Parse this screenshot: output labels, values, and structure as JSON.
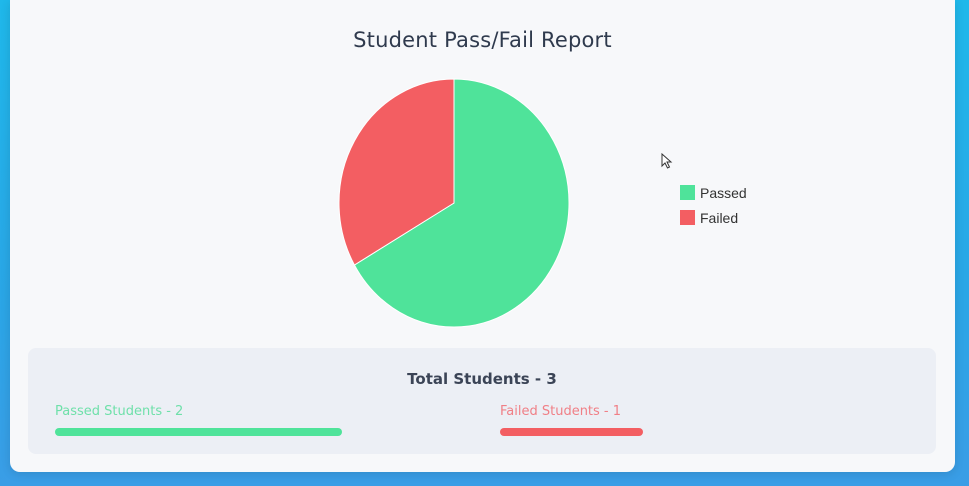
{
  "chart_data": {
    "type": "pie",
    "title": "Student Pass/Fail Report",
    "labels": [
      "Passed",
      "Failed"
    ],
    "values": [
      2,
      1
    ],
    "colors": [
      "#4fe39a",
      "#f35e62"
    ],
    "legend_position": "right"
  },
  "summary": {
    "total_label": "Total Students - 3",
    "passed_label": "Passed Students - 2",
    "failed_label": "Failed Students - 1",
    "passed_fraction": 0.6667,
    "failed_fraction": 0.3333,
    "passed_color": "#4fe39a",
    "failed_color": "#f35e62",
    "passed_text_color": "#6fe0aa",
    "failed_text_color": "#f07f86"
  },
  "icons": {
    "cursor": "mouse-pointer-icon"
  }
}
